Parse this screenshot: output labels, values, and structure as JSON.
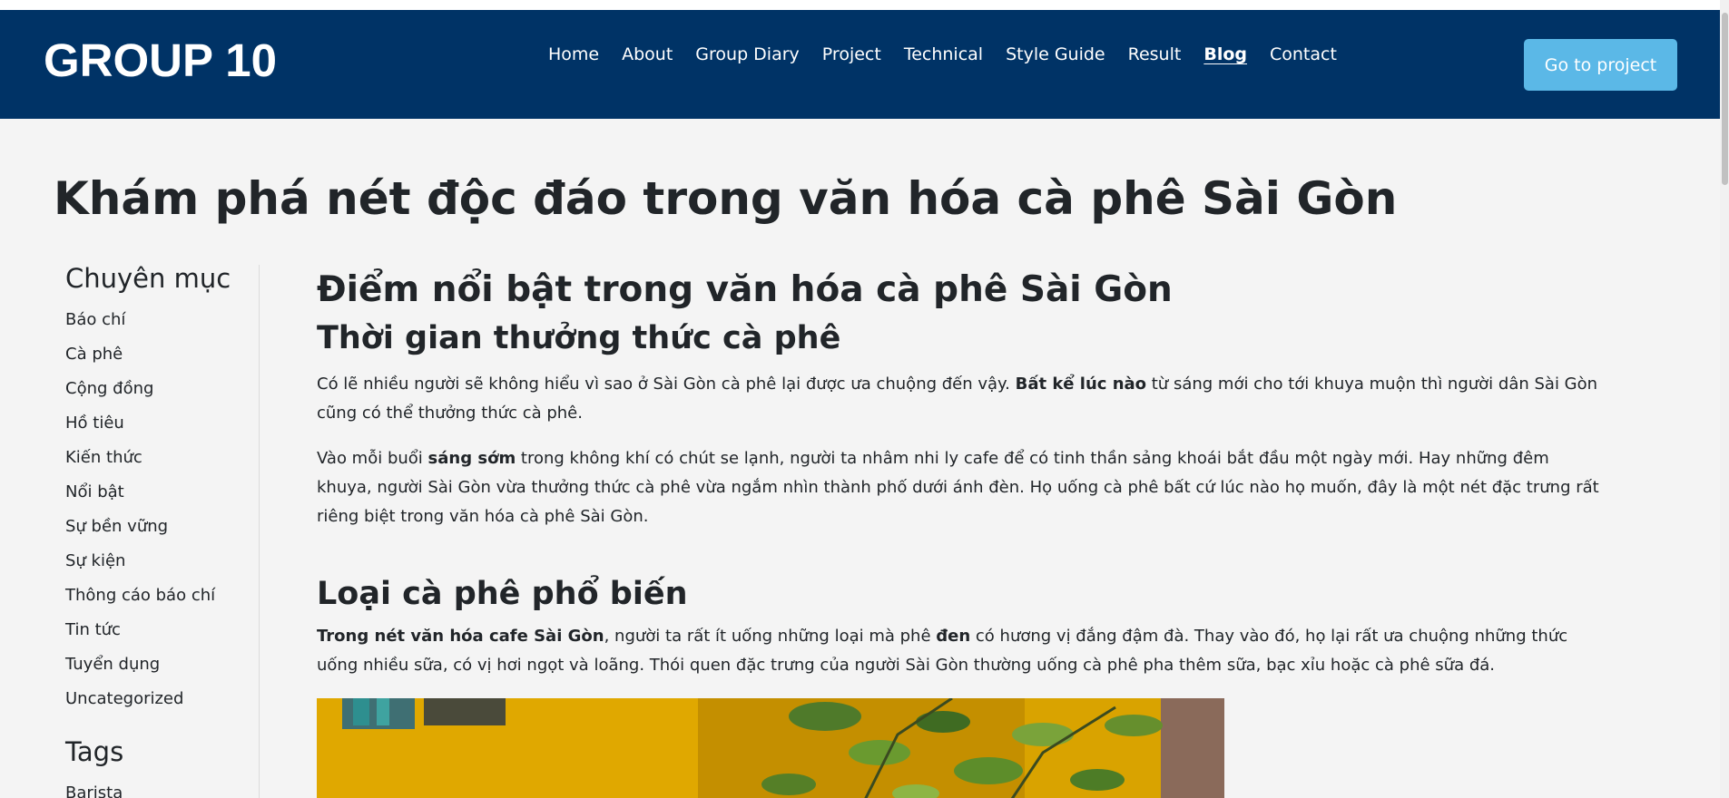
{
  "header": {
    "logo": "GROUP 10",
    "nav": [
      {
        "label": "Home"
      },
      {
        "label": "About"
      },
      {
        "label": "Group Diary"
      },
      {
        "label": "Project"
      },
      {
        "label": "Technical"
      },
      {
        "label": "Style Guide"
      },
      {
        "label": "Result"
      },
      {
        "label": "Blog",
        "active": true
      },
      {
        "label": "Contact"
      }
    ],
    "cta_label": "Go to project"
  },
  "page_title": "Khám phá nét độc đáo trong văn hóa cà phê Sài Gòn",
  "sidebar": {
    "categories_heading": "Chuyên mục",
    "categories": [
      "Báo chí",
      "Cà phê",
      "Cộng đồng",
      "Hồ tiêu",
      "Kiến thức",
      "Nổi bật",
      "Sự bền vững",
      "Sự kiện",
      "Thông cáo báo chí",
      "Tin tức",
      "Tuyển dụng",
      "Uncategorized"
    ],
    "tags_heading": "Tags",
    "tags": [
      "Barista"
    ]
  },
  "article": {
    "h2": "Điểm nổi bật trong văn hóa cà phê Sài Gòn",
    "section1": {
      "heading": "Thời gian thưởng thức cà phê",
      "p1": {
        "before": "Có lẽ nhiều người sẽ không hiểu vì sao ở Sài Gòn cà phê lại được ưa chuộng đến vậy. ",
        "bold": "Bất kể lúc nào",
        "after": " từ sáng mới cho tới khuya muộn thì người dân Sài Gòn cũng có thể thưởng thức cà phê."
      },
      "p2": {
        "before": "Vào mỗi buổi ",
        "bold": "sáng sớm",
        "after": " trong không khí có chút se lạnh, người ta nhâm nhi ly cafe để có tinh thần sảng khoái bắt đầu một ngày mới. Hay những đêm khuya, người Sài Gòn vừa thưởng thức cà phê vừa ngắm nhìn thành phố dưới ánh đèn. Họ uống cà phê bất cứ lúc nào họ muốn, đây là một nét đặc trưng rất riêng biệt trong văn hóa cà phê Sài Gòn."
      }
    },
    "section2": {
      "heading": "Loại cà phê phổ biến",
      "p1": {
        "bold1": "Trong nét văn hóa cafe Sài Gòn",
        "mid": ", người ta rất ít uống những loại mà phê ",
        "bold2": "đen",
        "after": " có hương vị đắng đậm đà. Thay vào đó, họ lại rất ưa chuộng những thức uống nhiều sữa, có vị hơi ngọt và loãng. Thói quen đặc trưng của người Sài Gòn thường uống cà phê pha thêm sữa, bạc xỉu hoặc cà phê sữa đá."
      }
    }
  },
  "colors": {
    "header_bg": "#003366",
    "cta_bg": "#5bb8e7",
    "page_bg": "#f4f4f4",
    "text": "#212529"
  }
}
